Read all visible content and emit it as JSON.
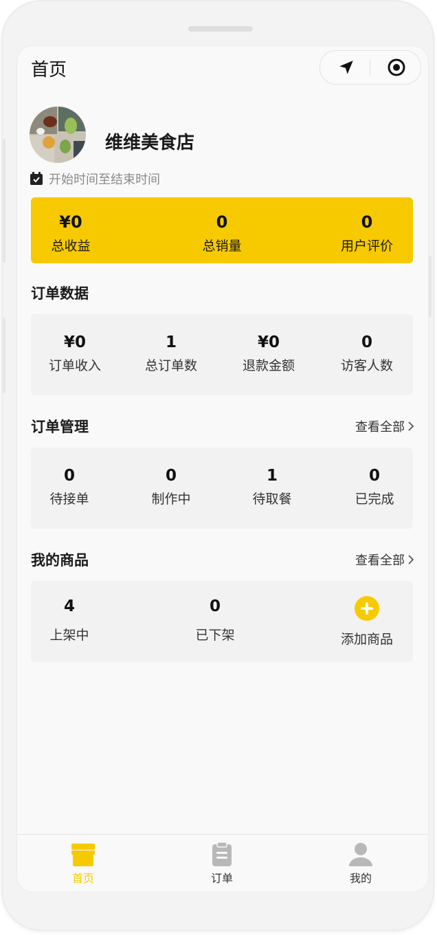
{
  "nav": {
    "title": "首页"
  },
  "shop": {
    "name": "维维美食店",
    "hours": "开始时间至结束时间"
  },
  "summary": [
    {
      "value": "¥0",
      "label": "总收益"
    },
    {
      "value": "0",
      "label": "总销量"
    },
    {
      "value": "0",
      "label": "用户评价"
    }
  ],
  "order_data": {
    "title": "订单数据",
    "items": [
      {
        "value": "¥0",
        "label": "订单收入"
      },
      {
        "value": "1",
        "label": "总订单数"
      },
      {
        "value": "¥0",
        "label": "退款金额"
      },
      {
        "value": "0",
        "label": "访客人数"
      }
    ]
  },
  "order_mgmt": {
    "title": "订单管理",
    "see_all": "查看全部",
    "items": [
      {
        "value": "0",
        "label": "待接单"
      },
      {
        "value": "0",
        "label": "制作中"
      },
      {
        "value": "1",
        "label": "待取餐"
      },
      {
        "value": "0",
        "label": "已完成"
      }
    ]
  },
  "products": {
    "title": "我的商品",
    "see_all": "查看全部",
    "items": [
      {
        "value": "4",
        "label": "上架中"
      },
      {
        "value": "0",
        "label": "已下架"
      }
    ],
    "add_label": "添加商品"
  },
  "tabbar": [
    {
      "label": "首页",
      "icon": "store-icon",
      "active": true
    },
    {
      "label": "订单",
      "icon": "clipboard-icon",
      "active": false
    },
    {
      "label": "我的",
      "icon": "user-icon",
      "active": false
    }
  ],
  "colors": {
    "accent": "#f7ca00",
    "inactive": "#8c8c8c"
  }
}
